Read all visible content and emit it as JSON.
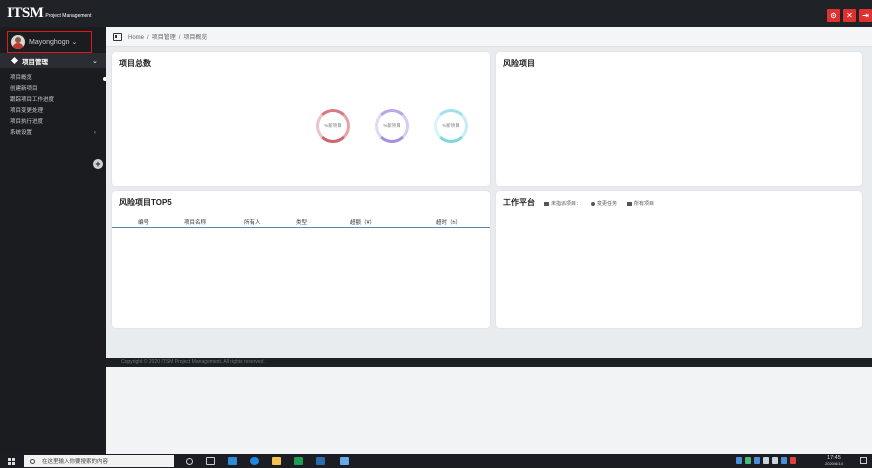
{
  "app": {
    "logo_text": "ITSM",
    "logo_sub": "Project Management"
  },
  "topbar": {
    "buttons": [
      "⊙",
      "✕",
      "⇥"
    ]
  },
  "sidebar": {
    "user_name": "Mayonghogn",
    "user_caret": "⌄",
    "menu_title": "项目管理",
    "menu_chevron": "⌄",
    "items": [
      {
        "label": "项目概览"
      },
      {
        "label": "创建新项目"
      },
      {
        "label": "跟踪项目工作进度"
      },
      {
        "label": "项目变更处理"
      },
      {
        "label": "项目执行进度"
      },
      {
        "label": "系统设置",
        "caret": "‹"
      }
    ],
    "add_label": "+"
  },
  "breadcrumb": {
    "items": [
      "Home",
      "项目管理",
      "项目概览"
    ],
    "separator": "/"
  },
  "cards": {
    "total": {
      "title": "项目总数",
      "rings": [
        {
          "label": "%新项目",
          "color": "#d87a84"
        },
        {
          "label": "%新项目",
          "color": "#b9a8e3"
        },
        {
          "label": "%新项目",
          "color": "#9fe2e8"
        }
      ]
    },
    "risk": {
      "title": "风险项目"
    },
    "top5": {
      "title": "风险项目TOP5",
      "columns": [
        "编号",
        "项目名称",
        "所有人",
        "类型",
        "超额（¥）",
        "超时（h）"
      ],
      "header_line_color": "#5b89b5"
    },
    "workbench": {
      "title": "工作平台",
      "links": [
        "未指派项目：",
        "变更任务",
        "所有项目"
      ]
    }
  },
  "footer": {
    "text": "Copyright © 2020 ITSM Project Management. All rights reserved."
  },
  "taskbar": {
    "search_placeholder": "在这里输入你要搜索的内容",
    "clock_time": "17:45",
    "clock_date": "2020/6/14"
  }
}
